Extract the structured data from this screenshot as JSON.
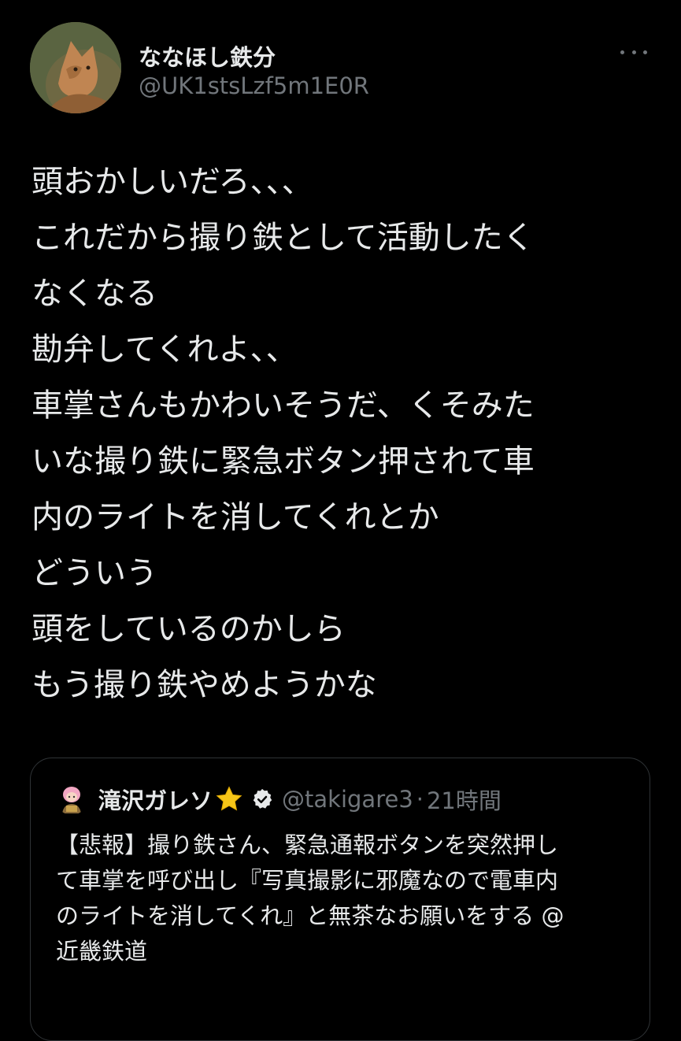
{
  "tweet": {
    "author": {
      "display_name": "ななほし鉄分",
      "handle": "@UK1stsLzf5m1E0R"
    },
    "more_icon": "more-horizontal-icon",
    "lines": [
      "頭おかしいだろ、、、",
      "これだから撮り鉄として活動したく",
      "なくなる",
      "勘弁してくれよ、、",
      "車掌さんもかわいそうだ、くそみた",
      "いな撮り鉄に緊急ボタン押されて車",
      "内のライトを消してくれとか",
      "どういう",
      "頭をしているのかしら",
      "もう撮り鉄やめようかな"
    ]
  },
  "quoted_tweet": {
    "author": {
      "display_name": "滝沢ガレソ",
      "badge_emoji": "star-icon",
      "verified_icon": "verified-badge-icon",
      "handle": "@takigare3",
      "separator": "·",
      "time": "21時間"
    },
    "lines": [
      "【悲報】撮り鉄さん、緊急通報ボタンを突然押し",
      "て車掌を呼び出し『写真撮影に邪魔なので電車内",
      "のライトを消してくれ』と無茶なお願いをする @",
      "近畿鉄道"
    ]
  },
  "colors": {
    "background": "#000000",
    "text_primary": "#e7e9ea",
    "text_secondary": "#71767b",
    "border": "#2f3336",
    "star": "#f5c518"
  }
}
